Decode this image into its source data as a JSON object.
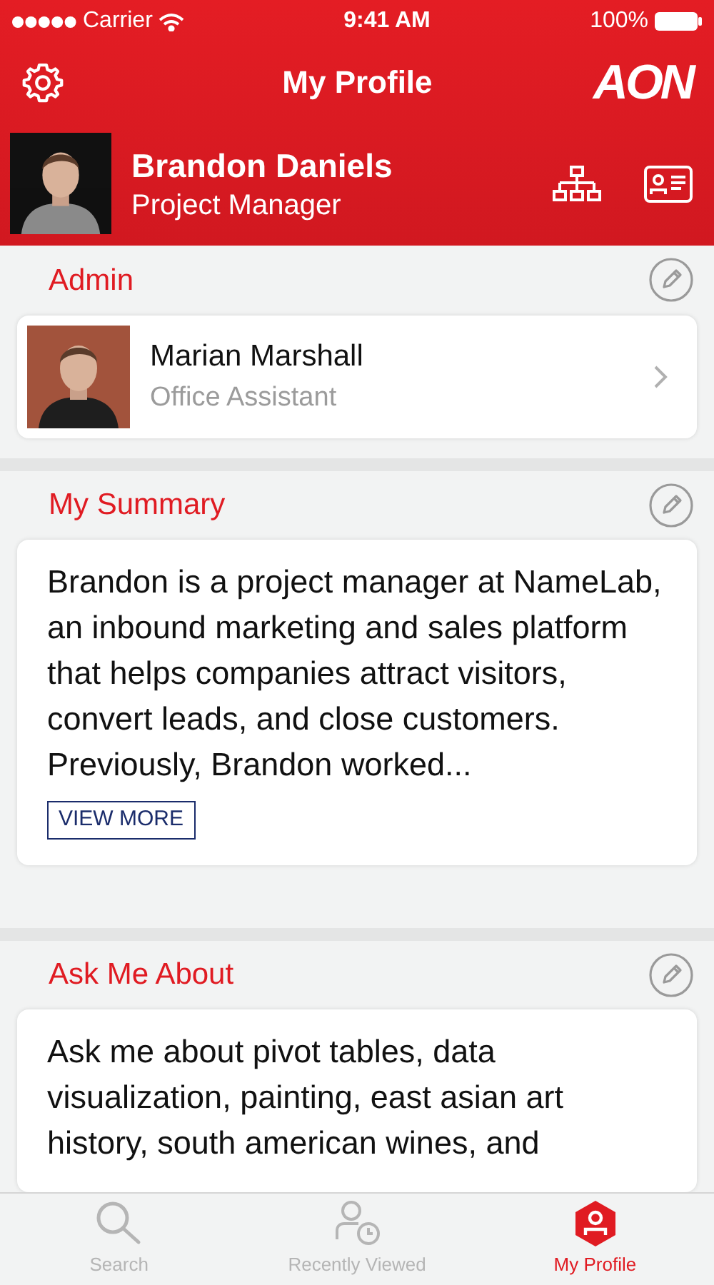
{
  "status_bar": {
    "carrier": "Carrier",
    "time": "9:41 AM",
    "battery": "100%"
  },
  "nav": {
    "title": "My Profile",
    "logo": "AON"
  },
  "profile": {
    "name": "Brandon Daniels",
    "role": "Project Manager"
  },
  "admin": {
    "heading": "Admin",
    "name": "Marian Marshall",
    "role": "Office Assistant"
  },
  "summary": {
    "heading": "My Summary",
    "text": "Brandon is a project manager at NameLab, an inbound marketing and sales platform that helps companies attract visitors, convert leads, and close customers. Previously, Brandon worked...",
    "button": "VIEW MORE"
  },
  "ask": {
    "heading": "Ask Me About",
    "text": "Ask me about pivot tables, data visualization, painting, east asian art history, south american wines, and"
  },
  "tabs": [
    {
      "label": "Search",
      "kind": "search",
      "selected": false
    },
    {
      "label": "Recently Viewed",
      "kind": "recent",
      "selected": false
    },
    {
      "label": "My Profile",
      "kind": "profile",
      "selected": true
    }
  ]
}
